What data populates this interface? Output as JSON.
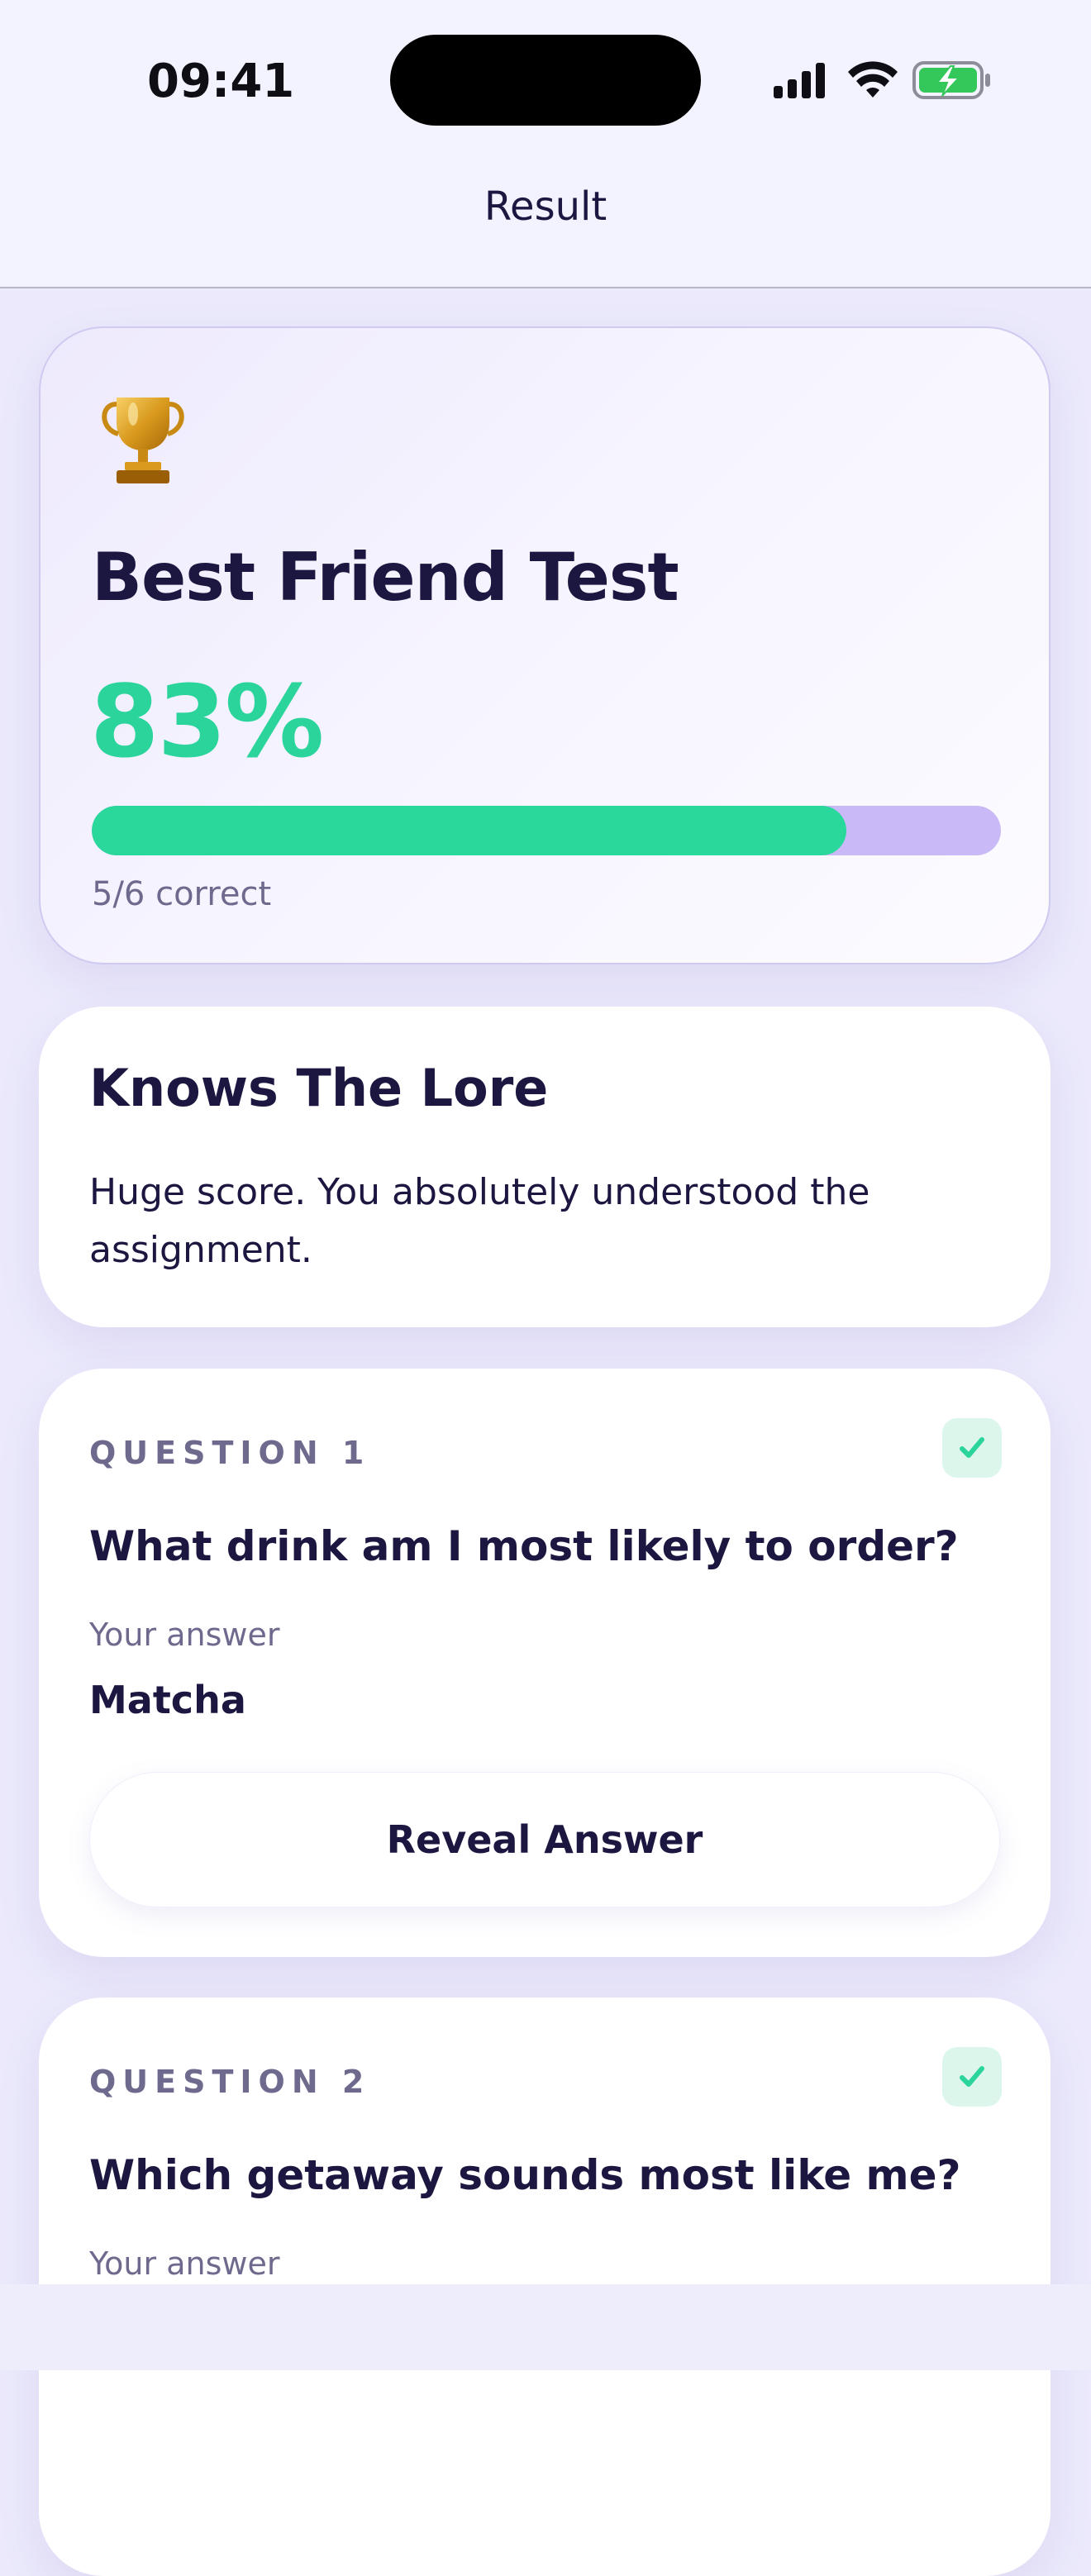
{
  "status_bar": {
    "time": "09:41"
  },
  "header": {
    "title": "Result"
  },
  "result": {
    "trophy_emoji": "🏆",
    "quiz_title": "Best Friend Test",
    "score_percent_label": "83%",
    "score_fraction": 0.83,
    "correct_label": "5/6 correct"
  },
  "verdict": {
    "title": "Knows The Lore",
    "description": "Huge score. You absolutely understood the assignment."
  },
  "questions": [
    {
      "label": "QUESTION 1",
      "text": "What drink am I most likely to order?",
      "answer_label": "Your answer",
      "answer": "Matcha",
      "button_label": "Reveal Answer",
      "correct": true
    },
    {
      "label": "QUESTION 2",
      "text": "Which getaway sounds most like me?",
      "answer_label": "Your answer",
      "correct": true
    }
  ],
  "colors": {
    "accent_green": "#2bd49b",
    "progress_track": "#c9b9f6",
    "text_dark": "#1c1740",
    "text_muted": "#6e6a8e"
  },
  "icons": {
    "signal": "cellular-signal-icon",
    "wifi": "wifi-icon",
    "battery": "battery-charging-icon",
    "check": "check-icon",
    "trophy": "trophy-icon"
  }
}
